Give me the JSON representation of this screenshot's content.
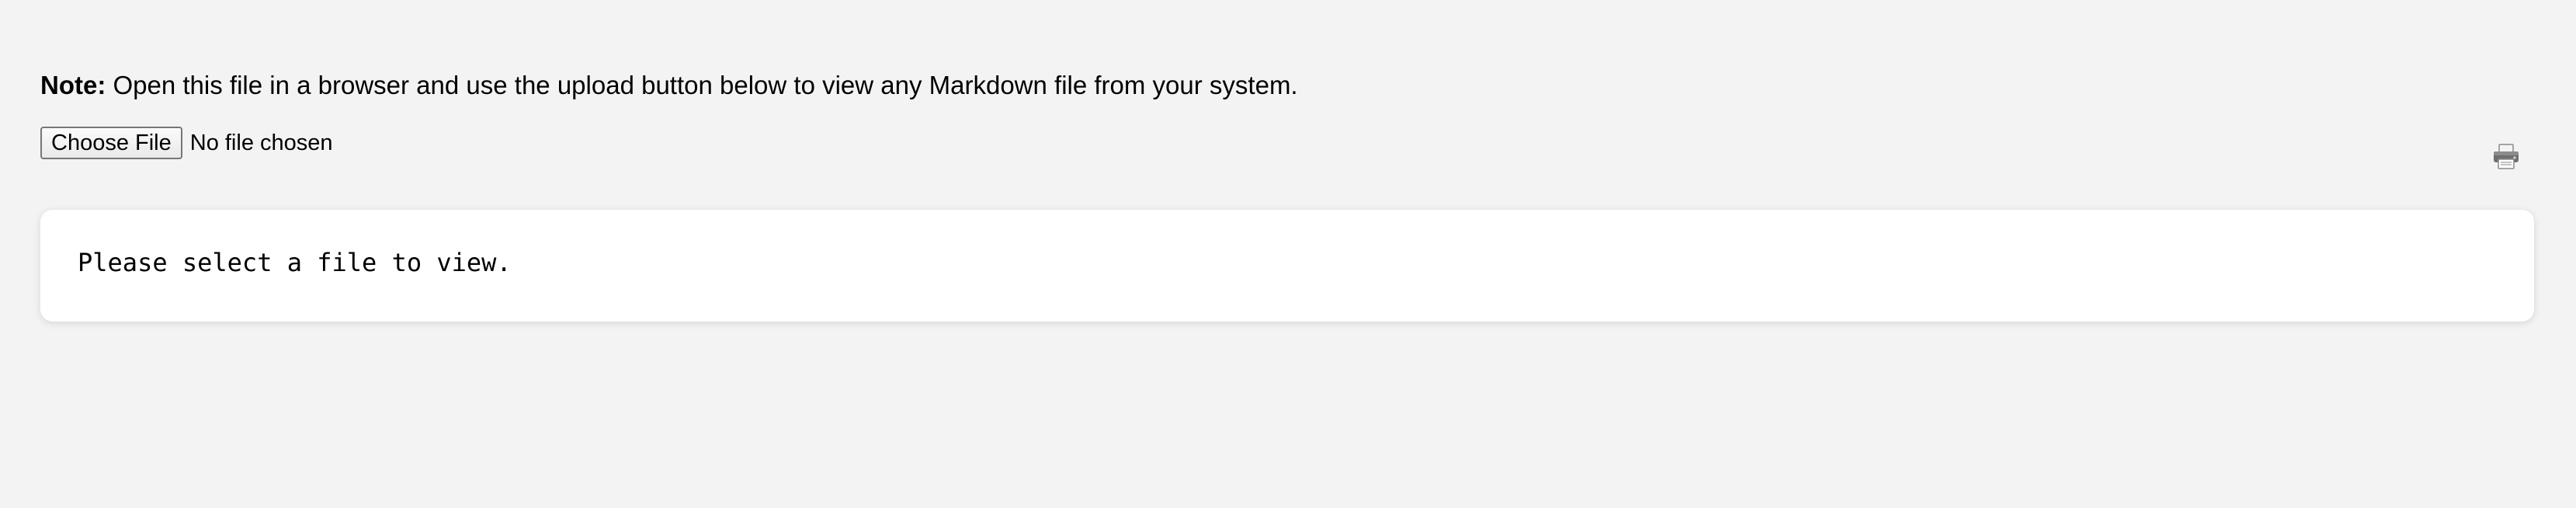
{
  "note": {
    "label": "Note:",
    "text": " Open this file in a browser and use the upload button below to view any Markdown file from your system."
  },
  "upload": {
    "button_label": "Choose File",
    "status": "No file chosen"
  },
  "toolbar": {
    "print_icon": "printer-icon"
  },
  "viewer": {
    "placeholder": "Please select a file to view."
  }
}
